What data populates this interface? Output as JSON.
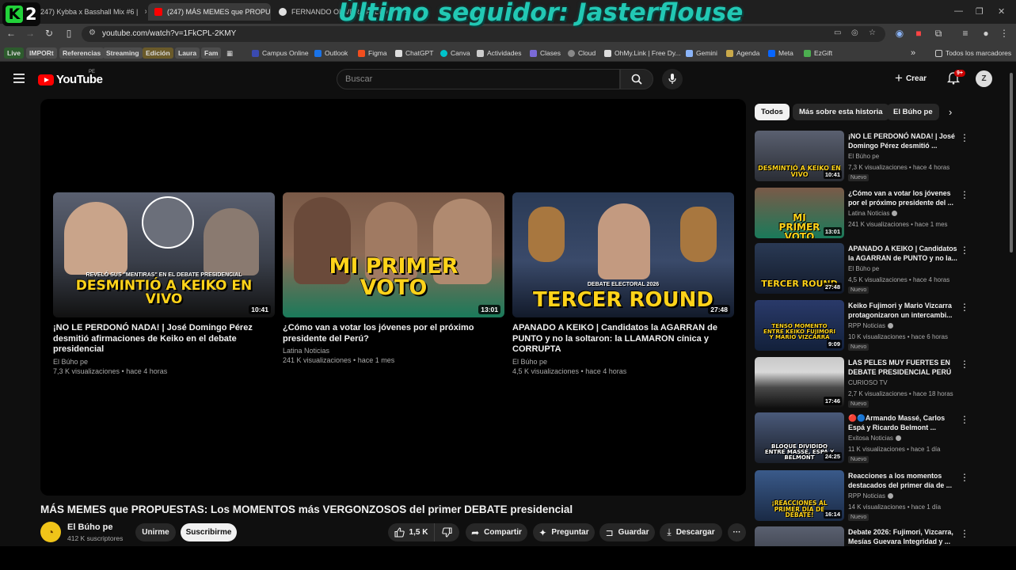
{
  "overlay": {
    "stream_logo_number": "2",
    "follower_text": "Último seguidor: Jasterflouse"
  },
  "tabs": [
    {
      "label": "(247) Kybba x Basshall Mix #6 |",
      "close": "×"
    },
    {
      "label": "(247) MÁS MEMES que PROPU",
      "close": "×"
    },
    {
      "label": "FERNANDO OLIVERA FALTO",
      "close": "×"
    }
  ],
  "new_tab": "+",
  "address": {
    "url": "youtube.com/watch?v=1FkCPL-2KMY"
  },
  "bookmarks": {
    "chips": [
      "Live",
      "IMPORt",
      "Referencias",
      "Streaming",
      "Edición",
      "Laura",
      "Fam"
    ],
    "links": [
      "Campus Online",
      "Outlook",
      "Figma",
      "ChatGPT",
      "Canva",
      "Actividades",
      "Clases",
      "Cloud",
      "OhMy.Link | Free Dy...",
      "Gemini",
      "Agenda",
      "Meta",
      "EzGift"
    ],
    "overflow": "»",
    "all_bookmarks": "Todos los marcadores"
  },
  "youtube": {
    "logo_text": "YouTube",
    "country": "PE",
    "search_placeholder": "Buscar",
    "create_label": "Crear",
    "notif_badge": "9+",
    "account_initial": "Z"
  },
  "end_screen": [
    {
      "title": "¡NO LE PERDONÓ NADA! | José Domingo Pérez desmitió afirmaciones de Keiko en el debate presidencial",
      "channel": "El Búho pe",
      "meta": "7,3 K visualizaciones • hace 4 horas",
      "duration": "10:41",
      "thumb_tag": "REVELÓ SUS \"MENTIRAS\" EN EL DEBATE PRESIDENCIAL",
      "thumb_text": "DESMINTIÓ A KEIKO EN VIVO"
    },
    {
      "title": "¿Cómo van a votar los jóvenes por el próximo presidente del Perú?",
      "channel": "Latina Noticias",
      "meta": "241 K visualizaciones • hace 1 mes",
      "duration": "13:01",
      "thumb_tag": "",
      "thumb_text": "MI PRIMER VOTO"
    },
    {
      "title": "APANADO A KEIKO | Candidatos la AGARRAN de PUNTO y no la soltaron: la LLAMARON cínica y CORRUPTA",
      "channel": "El Búho pe",
      "meta": "4,5 K visualizaciones • hace 4 horas",
      "duration": "27:48",
      "thumb_tag": "DEBATE ELECTORAL 2026",
      "thumb_text": "TERCER ROUND"
    }
  ],
  "video": {
    "title": "MÁS MEMES que PROPUESTAS: Los MOMENTOS más VERGONZOSOS del primer DEBATE presidencial",
    "channel": "El Búho pe",
    "subscribers": "412 K suscriptores",
    "join_label": "Unirme",
    "subscribe_label": "Suscribirme",
    "likes": "1,5 K",
    "share_label": "Compartir",
    "ask_label": "Preguntar",
    "save_label": "Guardar",
    "download_label": "Descargar",
    "more_label": "···"
  },
  "filter_chips": [
    "Todos",
    "Más sobre esta historia",
    "El Búho pe"
  ],
  "recommendations": [
    {
      "title": "¡NO LE PERDONÓ NADA! | José Domingo Pérez desmitió ...",
      "channel": "El Búho pe",
      "verified": false,
      "meta": "7,3 K visualizaciones • hace 4 horas",
      "badge": "Nuevo",
      "duration": "10:41",
      "caption": "DESMINTIÓ A KEIKO EN VIVO"
    },
    {
      "title": "¿Cómo van a votar los jóvenes por el próximo presidente del ...",
      "channel": "Latina Noticias",
      "verified": true,
      "meta": "241 K visualizaciones • hace 1 mes",
      "badge": "",
      "duration": "13:01",
      "caption": "MI PRIMER VOTO"
    },
    {
      "title": "APANADO A KEIKO | Candidatos la AGARRAN de PUNTO y no la...",
      "channel": "El Búho pe",
      "verified": false,
      "meta": "4,5 K visualizaciones • hace 4 horas",
      "badge": "Nuevo",
      "duration": "27:48",
      "caption": "TERCER ROUND"
    },
    {
      "title": "Keiko Fujimori y Mario Vizcarra protagonizaron un intercambi...",
      "channel": "RPP Noticias",
      "verified": true,
      "meta": "10 K visualizaciones • hace 6 horas",
      "badge": "Nuevo",
      "duration": "9:09",
      "caption": "TENSO MOMENTO ENTRE KEIKO FUJIMORI Y MARIO VIZCARRA"
    },
    {
      "title": "LAS PELES MUY FUERTES EN DEBATE PRESIDENCIAL PERÚ ...",
      "channel": "CURIOSO TV",
      "verified": false,
      "meta": "2,7 K visualizaciones • hace 18 horas",
      "badge": "Nuevo",
      "duration": "17:46",
      "caption": ""
    },
    {
      "title": "🔴🔵Armando Massé, Carlos Espá y Ricardo Belmont ...",
      "channel": "Exitosa Noticias",
      "verified": true,
      "meta": "11 K visualizaciones • hace 1 día",
      "badge": "Nuevo",
      "duration": "24:25",
      "caption": "BLOQUE DIVIDIDO ENTRE MASSÉ, ESPÁ Y BELMONT"
    },
    {
      "title": "Reacciones a los momentos destacados del primer día de ...",
      "channel": "RPP Noticias",
      "verified": true,
      "meta": "14 K visualizaciones • hace 1 día",
      "badge": "Nuevo",
      "duration": "16:14",
      "caption": "¡REACCIONES AL PRIMER DÍA DE DEBATE!"
    },
    {
      "title": "Debate 2026: Fujimori, Vizcarra, Mesías Guevara Integridad y ...",
      "channel": "",
      "verified": false,
      "meta": "",
      "badge": "",
      "duration": "",
      "caption": ""
    }
  ],
  "colors": {
    "brand_red": "#ff0000",
    "overlay_teal": "#22c8b4",
    "caption_yellow": "#ffd31a",
    "stream_green": "#22d23a"
  },
  "icons": [
    "menu-icon",
    "search-icon",
    "mic-icon",
    "bell-icon",
    "like-icon",
    "dislike-icon",
    "share-icon",
    "sparkle-icon",
    "save-icon",
    "download-icon",
    "more-icon",
    "chevron-right-icon"
  ]
}
